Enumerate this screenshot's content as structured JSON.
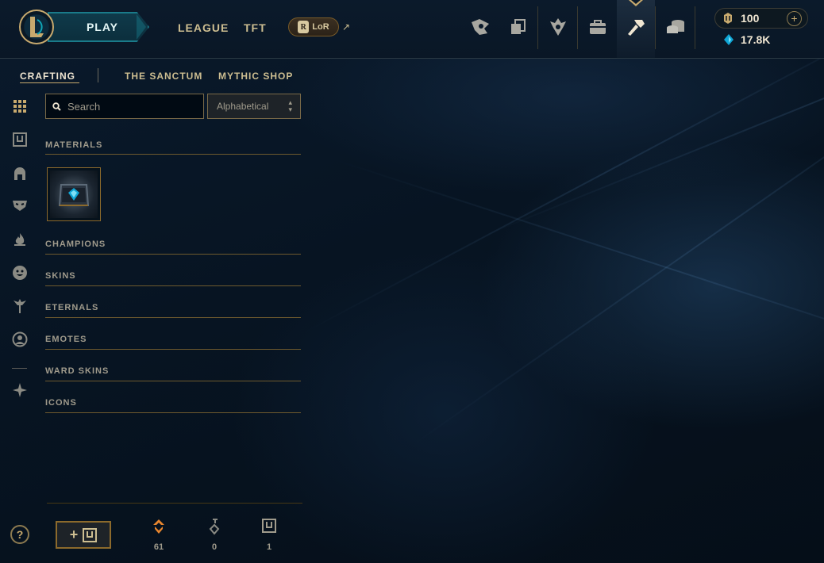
{
  "nav": {
    "play_label": "PLAY",
    "links": [
      "LEAGUE",
      "TFT"
    ],
    "lor_label": "LoR",
    "lor_badge": "R"
  },
  "top_icons": [
    "profile-icon",
    "collection-icon",
    "ranked-icon",
    "store-bag-icon",
    "loot-icon",
    "currency-coins-icon"
  ],
  "wallet": {
    "rp": "100",
    "be": "17.8K"
  },
  "subtabs": [
    "CRAFTING",
    "THE SANCTUM",
    "MYTHIC SHOP"
  ],
  "search": {
    "placeholder": "Search"
  },
  "sort": {
    "selected": "Alphabetical"
  },
  "rail_icons": [
    "grid-icon",
    "chest-icon",
    "helmet-icon",
    "mask-icon",
    "flame-icon",
    "emote-icon",
    "ward-icon",
    "profile-circle-icon",
    "misc-icon"
  ],
  "categories": [
    "MATERIALS",
    "CHAMPIONS",
    "SKINS",
    "ETERNALS",
    "EMOTES",
    "WARD SKINS",
    "ICONS"
  ],
  "bottom": {
    "add_label": "+",
    "counters": [
      {
        "icon": "orange-essence-icon",
        "value": "61"
      },
      {
        "icon": "key-fragment-icon",
        "value": "0"
      },
      {
        "icon": "chest-counter-icon",
        "value": "1"
      }
    ]
  },
  "help_label": "?",
  "colors": {
    "gold": "#c8aa6e",
    "text_gold": "#cdbe91",
    "teal": "#1a7b8a",
    "background": "#06101b"
  }
}
